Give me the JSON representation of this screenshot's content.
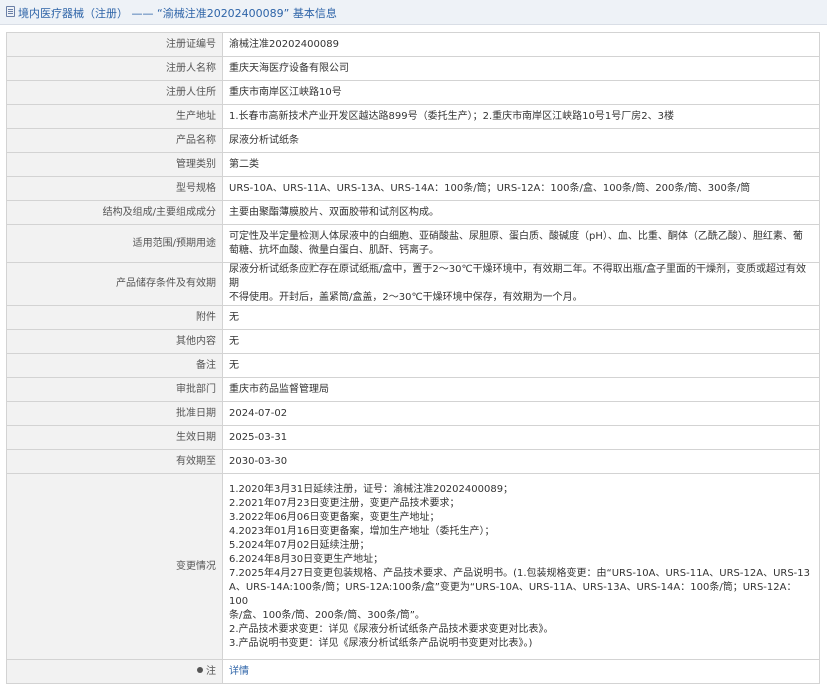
{
  "title": {
    "text": "境内医疗器械（注册） —— “渝械注准20202400089” 基本信息"
  },
  "rows": [
    {
      "label": "注册证编号",
      "value": "渝械注准20202400089"
    },
    {
      "label": "注册人名称",
      "value": "重庆天海医疗设备有限公司"
    },
    {
      "label": "注册人住所",
      "value": "重庆市南岸区江峡路10号"
    },
    {
      "label": "生产地址",
      "value": "1.长春市高新技术产业开发区越达路899号（委托生产）；2.重庆市南岸区江峡路10号1号厂房2、3楼"
    },
    {
      "label": "产品名称",
      "value": "尿液分析试纸条"
    },
    {
      "label": "管理类别",
      "value": "第二类"
    },
    {
      "label": "型号规格",
      "value": "URS-10A、URS-11A、URS-13A、URS-14A：100条/筒；URS-12A：100条/盒、100条/筒、200条/筒、300条/筒"
    },
    {
      "label": "结构及组成/主要组成成分",
      "value": "主要由聚酯薄膜胶片、双面胶带和试剂区构成。"
    },
    {
      "label": "适用范围/预期用途",
      "lines": [
        "可定性及半定量检测人体尿液中的白细胞、亚硝酸盐、尿胆原、蛋白质、酸碱度（pH）、血、比重、酮体（乙酰乙酸）、胆红素、葡",
        "萄糖、抗坏血酸、微量白蛋白、肌酐、钙离子。"
      ]
    },
    {
      "label": "产品储存条件及有效期",
      "lines": [
        "尿液分析试纸条应贮存在原试纸瓶/盒中，置于2～30℃干燥环境中，有效期二年。不得取出瓶/盒子里面的干燥剂，变质或超过有效期",
        "不得使用。开封后，盖紧筒/盒盖，2～30℃干燥环境中保存，有效期为一个月。"
      ]
    },
    {
      "label": "附件",
      "value": "无"
    },
    {
      "label": "其他内容",
      "value": "无"
    },
    {
      "label": "备注",
      "value": "无"
    },
    {
      "label": "审批部门",
      "value": "重庆市药品监督管理局"
    },
    {
      "label": "批准日期",
      "value": "2024-07-02"
    },
    {
      "label": "生效日期",
      "value": "2025-03-31"
    },
    {
      "label": "有效期至",
      "value": "2030-03-30"
    }
  ],
  "changes": {
    "label": "变更情况",
    "lines": [
      "1.2020年3月31日延续注册，证号：渝械注准20202400089；",
      "2.2021年07月23日变更注册，变更产品技术要求；",
      "3.2022年06月06日变更备案，变更生产地址；",
      "4.2023年01月16日变更备案，增加生产地址（委托生产）；",
      "5.2024年07月02日延续注册；",
      "6.2024年8月30日变更生产地址；",
      "7.2025年4月27日变更包装规格、产品技术要求、产品说明书。(1.包装规格变更：由“URS-10A、URS-11A、URS-12A、URS-13",
      "A、URS-14A:100条/筒；URS-12A:100条/盒”变更为“URS-10A、URS-11A、URS-13A、URS-14A：100条/筒；URS-12A：100",
      "条/盒、100条/筒、200条/筒、300条/筒”。",
      "2.产品技术要求变更：详见《尿液分析试纸条产品技术要求变更对比表》。",
      "3.产品说明书变更：详见《尿液分析试纸条产品说明书变更对比表》。)"
    ]
  },
  "note": {
    "label": "注",
    "icon": "pin-icon",
    "link_text": "详情"
  }
}
